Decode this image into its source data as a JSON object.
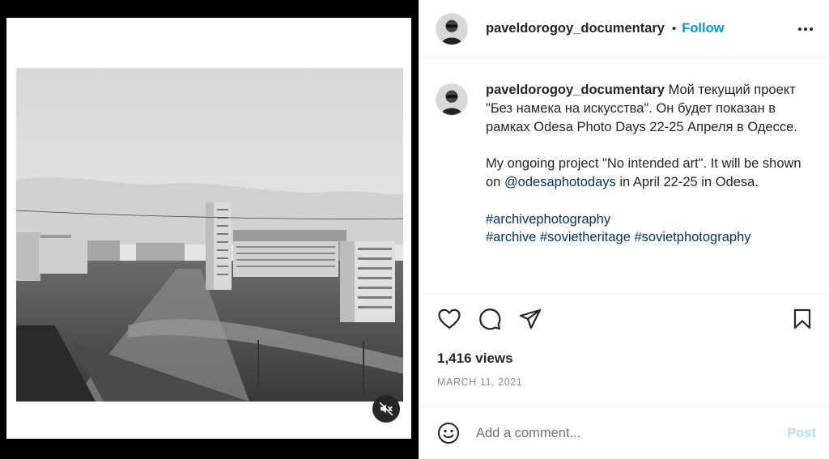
{
  "post": {
    "username": "paveldorogoy_documentary",
    "dot": "•",
    "follow_label": "Follow",
    "more_icon": "more-horizontal-icon"
  },
  "caption": {
    "username": "paveldorogoy_documentary",
    "ru_text": "Мой текущий проект \"Без намека на искусства\". Он будет показан в рамках Odesa Photo Days 22-25 Апреля в Одессе.",
    "en_text_before": "My ongoing project \"No intended art\". It will be shown on ",
    "en_mention": "@odesaphotodays",
    "en_text_after": " in April 22-25 in Odesa.",
    "hashtags_line1": [
      "#archivephotography"
    ],
    "hashtags_line2": [
      "#archive",
      "#sovietheritage",
      "#sovietphotography"
    ]
  },
  "stats": {
    "views": "1,416 views",
    "date": "MARCH 11, 2021"
  },
  "comment": {
    "placeholder": "Add a comment...",
    "post_label": "Post"
  },
  "colors": {
    "accent": "#0095f6",
    "link": "#00376b",
    "post_disabled": "#b2dffc",
    "muted": "#8e8e8e"
  }
}
